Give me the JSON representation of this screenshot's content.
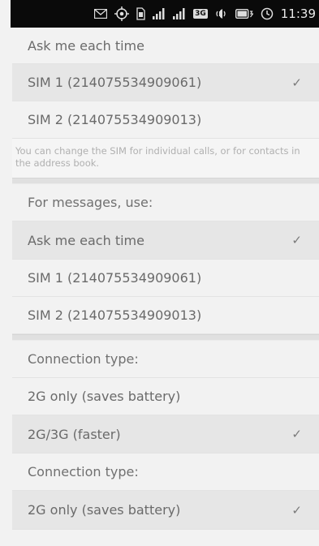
{
  "status_bar": {
    "time": "11:39",
    "icons": [
      "message-icon",
      "gps-icon",
      "sim-icon",
      "signal-icon",
      "signal-icon",
      "3g-icon",
      "volume-icon",
      "battery-charging-icon",
      "clock-icon"
    ],
    "network_label": "3G"
  },
  "calls_section": {
    "options": [
      {
        "label": "Ask me each time",
        "selected": false
      },
      {
        "label": "SIM 1 (214075534909061)",
        "selected": true
      },
      {
        "label": "SIM 2 (214075534909013)",
        "selected": false
      }
    ],
    "note": "You can change the SIM for individual calls, or for contacts in the address book."
  },
  "messages_section": {
    "heading": "For messages, use:",
    "options": [
      {
        "label": "Ask me each time",
        "selected": true
      },
      {
        "label": "SIM 1 (214075534909061)",
        "selected": false
      },
      {
        "label": "SIM 2 (214075534909013)",
        "selected": false
      }
    ]
  },
  "connection_section_1": {
    "heading": "Connection type:",
    "options": [
      {
        "label": "2G only (saves battery)",
        "selected": false
      },
      {
        "label": "2G/3G (faster)",
        "selected": true
      }
    ]
  },
  "connection_section_2": {
    "heading": "Connection type:",
    "options": [
      {
        "label": "2G only (saves battery)",
        "selected": true
      }
    ]
  },
  "check_glyph": "✓",
  "colors": {
    "selected_row": "#e6e6e6",
    "background": "#f2f2f2",
    "status_bar": "#0a0a0a"
  }
}
